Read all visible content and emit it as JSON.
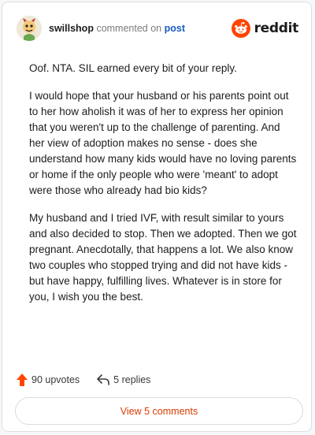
{
  "comment": {
    "username": "swillshop",
    "commented_on_text": "commented on",
    "post_link": "post",
    "brand": "reddit",
    "paragraphs": [
      "Oof. NTA. SIL earned every bit of your reply.",
      "I would hope that your husband or his parents point out to her how aholish it was of her to express her opinion that you weren't up to the challenge of parenting. And her view of adoption makes no sense - does she understand how many kids would have no loving parents or home if the only people who were 'meant' to adopt were those who already had bio kids?",
      "My husband and I tried IVF, with result similar to yours and also decided to stop. Then we adopted. Then we got pregnant. Anecdotally, that happens a lot. We also know two couples who stopped trying and did not have kids - but have happy, fulfilling lives. Whatever is in store for you, I wish you the best."
    ],
    "upvotes_label": "90 upvotes",
    "replies_label": "5 replies",
    "view_comments_label": "View 5 comments"
  },
  "icons": {
    "avatar": "avatar-icon",
    "logo": "reddit-logo-icon",
    "upvote": "upvote-arrow-icon",
    "reply": "reply-arrow-icon"
  },
  "colors": {
    "brand": "#ff4500",
    "upvote": "#ff4500",
    "link": "#1a5bbf",
    "view_button_text": "#d93a00"
  }
}
